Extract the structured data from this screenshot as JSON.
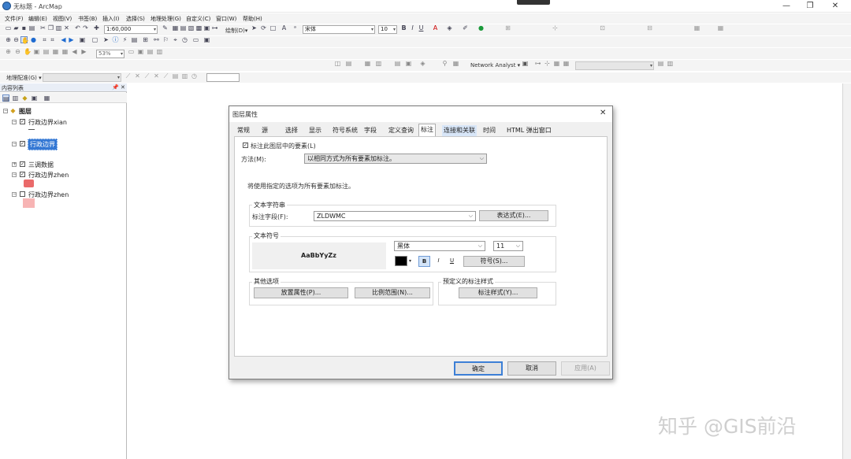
{
  "window": {
    "title": "无标题 - ArcMap",
    "minimize": "—",
    "maximize": "❐",
    "close": "✕"
  },
  "menu": [
    "文件(F)",
    "编辑(E)",
    "视图(V)",
    "书签(B)",
    "插入(I)",
    "选择(S)",
    "地理处理(G)",
    "自定义(C)",
    "窗口(W)",
    "帮助(H)"
  ],
  "toolbar": {
    "scale": "1:60,000",
    "draw_label": "绘制(D)▾",
    "font_name": "宋体",
    "font_size": "10",
    "bold": "B",
    "italic": "I",
    "underline": "U",
    "zoom_percent": "53%",
    "network_analyst": "Network Analyst ▾",
    "georef_label": "地理配准(G) ▾"
  },
  "toc": {
    "title": "内容列表",
    "pin": "📌 ✕",
    "root": "图层",
    "layers": [
      {
        "name": "行政边界xian",
        "checked": true
      },
      {
        "name": "行政边界",
        "checked": true,
        "selected": true
      },
      {
        "name": "三调数据",
        "checked": true
      },
      {
        "name": "行政边界zhen",
        "checked": true
      },
      {
        "name": "行政边界zhen",
        "checked": false
      }
    ]
  },
  "dialog": {
    "title": "图层属性",
    "close": "✕",
    "tabs": [
      "常规",
      "源",
      "选择",
      "显示",
      "符号系统",
      "字段",
      "定义查询",
      "标注",
      "连接和关联",
      "时间",
      "HTML 弹出窗口"
    ],
    "active_tab": "标注",
    "label_checkbox": "标注此图层中的要素(L)",
    "method_label": "方法(M):",
    "method_value": "以相同方式为所有要素加标注。",
    "info_text": "将使用指定的选项为所有要素加标注。",
    "text_string_group": "文本字符串",
    "label_field_label": "标注字段(F):",
    "label_field_value": "ZLDWMC",
    "expression_button": "表达式(E)...",
    "text_symbol_group": "文本符号",
    "preview_text": "AaBbYyZz",
    "font_value": "黑体",
    "size_value": "11",
    "bold": "B",
    "italic": "I",
    "underline": "U",
    "symbol_button": "符号(S)...",
    "other_options_group": "其他选项",
    "placement_button": "放置属性(P)...",
    "scale_range_button": "比例范围(N)...",
    "predefined_group": "预定义的标注样式",
    "label_styles_button": "标注样式(Y)...",
    "ok": "确定",
    "cancel": "取消",
    "apply": "应用(A)",
    "font_color": "#000000"
  },
  "watermark": "知乎 @GIS前沿"
}
